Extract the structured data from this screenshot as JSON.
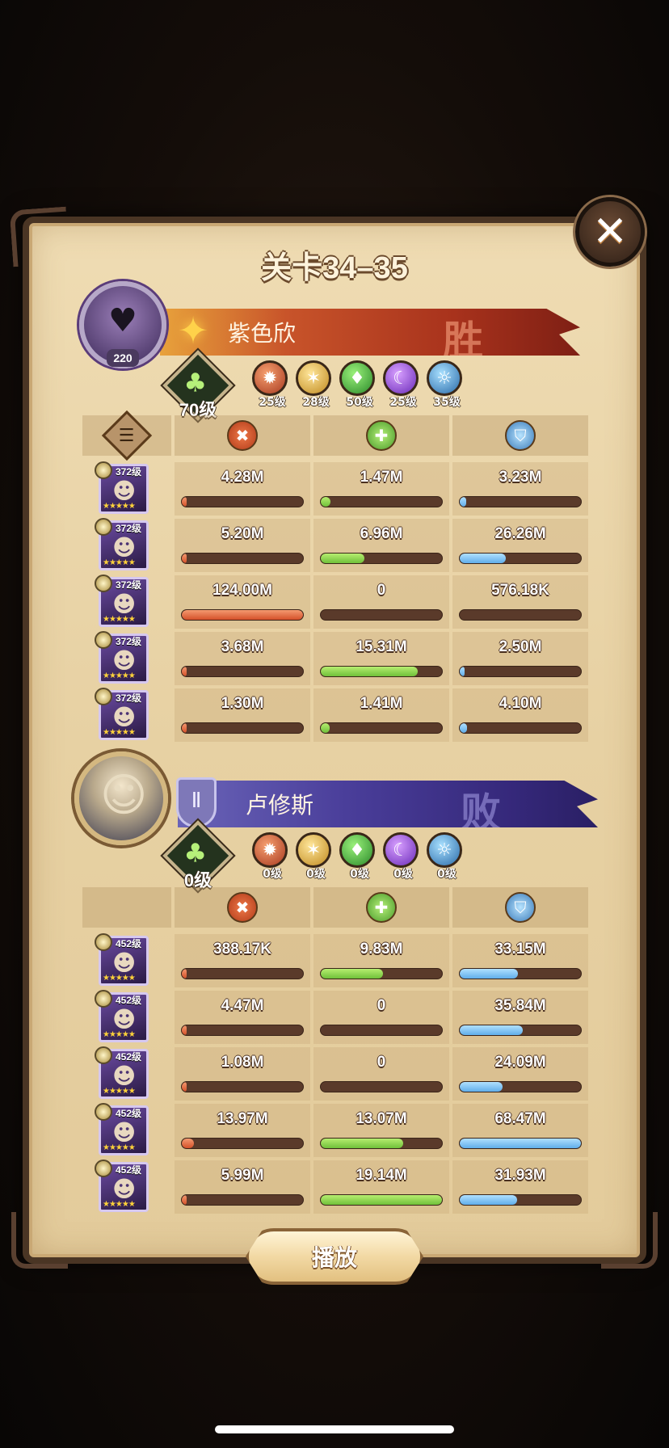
{
  "title": "关卡34–35",
  "close_icon": "close-icon",
  "player1": {
    "name": "紫色欣",
    "avatar_level": "220",
    "result": "胜",
    "tree_level": "70级",
    "factions": [
      {
        "icon": "lightbearer-icon",
        "level": "25级"
      },
      {
        "icon": "mauler-icon",
        "level": "28级"
      },
      {
        "icon": "wilder-icon",
        "level": "50级"
      },
      {
        "icon": "graveborn-icon",
        "level": "25级"
      },
      {
        "icon": "celestial-icon",
        "level": "35级"
      }
    ],
    "heroes": [
      {
        "level": "372级",
        "damage": "4.28M",
        "damage_pct": 0.03,
        "heal": "1.47M",
        "heal_pct": 0.08,
        "def": "3.23M",
        "def_pct": 0.05
      },
      {
        "level": "372级",
        "damage": "5.20M",
        "damage_pct": 0.04,
        "heal": "6.96M",
        "heal_pct": 0.36,
        "def": "26.26M",
        "def_pct": 0.38
      },
      {
        "level": "372级",
        "damage": "124.00M",
        "damage_pct": 1.0,
        "heal": "0",
        "heal_pct": 0.0,
        "def": "576.18K",
        "def_pct": 0.0
      },
      {
        "level": "372级",
        "damage": "3.68M",
        "damage_pct": 0.03,
        "heal": "15.31M",
        "heal_pct": 0.8,
        "def": "2.50M",
        "def_pct": 0.04
      },
      {
        "level": "372级",
        "damage": "1.30M",
        "damage_pct": 0.01,
        "heal": "1.41M",
        "heal_pct": 0.07,
        "def": "4.10M",
        "def_pct": 0.06
      }
    ]
  },
  "player2": {
    "name": "卢修斯",
    "result": "败",
    "tree_level": "0级",
    "factions": [
      {
        "icon": "lightbearer-icon",
        "level": "0级"
      },
      {
        "icon": "mauler-icon",
        "level": "0级"
      },
      {
        "icon": "wilder-icon",
        "level": "0级"
      },
      {
        "icon": "graveborn-icon",
        "level": "0级"
      },
      {
        "icon": "celestial-icon",
        "level": "0级"
      }
    ],
    "heroes": [
      {
        "level": "452级",
        "damage": "388.17K",
        "damage_pct": 0.03,
        "heal": "9.83M",
        "heal_pct": 0.51,
        "def": "33.15M",
        "def_pct": 0.48
      },
      {
        "level": "452级",
        "damage": "4.47M",
        "damage_pct": 0.03,
        "heal": "0",
        "heal_pct": 0.0,
        "def": "35.84M",
        "def_pct": 0.52
      },
      {
        "level": "452级",
        "damage": "1.08M",
        "damage_pct": 0.02,
        "heal": "0",
        "heal_pct": 0.0,
        "def": "24.09M",
        "def_pct": 0.35
      },
      {
        "level": "452级",
        "damage": "13.97M",
        "damage_pct": 0.1,
        "heal": "13.07M",
        "heal_pct": 0.68,
        "def": "68.47M",
        "def_pct": 1.0
      },
      {
        "level": "452级",
        "damage": "5.99M",
        "damage_pct": 0.04,
        "heal": "19.14M",
        "heal_pct": 1.0,
        "def": "31.93M",
        "def_pct": 0.47
      }
    ]
  },
  "table_headers": {
    "info_icon": "scroll-icon",
    "damage_icon": "damage-icon",
    "heal_icon": "heal-icon",
    "defense_icon": "defense-icon"
  },
  "play_button": "播放",
  "colors": {
    "damage": "#d4502a",
    "heal": "#70c03a",
    "defense": "#60aeea",
    "win_banner": "#a8321c",
    "lose_banner": "#4a3e9a"
  }
}
